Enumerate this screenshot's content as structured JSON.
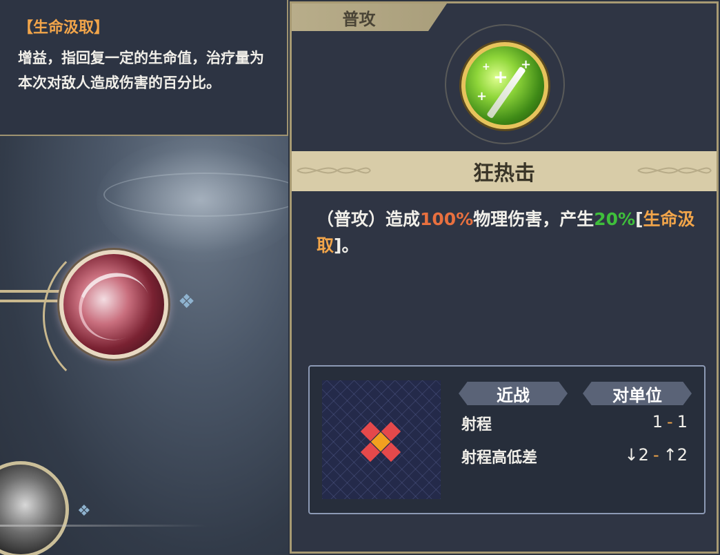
{
  "tooltip": {
    "title": "【生命汲取】",
    "body": "增益，指回复一定的生命值，治疗量为本次对敌人造成伤害的百分比。"
  },
  "panel": {
    "tab_label": "普攻",
    "skill_icon": "green-blade-icon",
    "skill_name": "狂热击",
    "description": {
      "prefix": "（普攻）造成",
      "damage_pct": "100%",
      "mid": "物理伤害，产生",
      "lifesteal_pct": "20%",
      "bracket_open": "[",
      "keyword": "生命汲取",
      "suffix": "]。"
    },
    "info": {
      "attack_type": "近战",
      "target_type": "对单位",
      "range_label": "射程",
      "range_min": "1",
      "range_max": "1",
      "height_label": "射程高低差",
      "height_down": "↓2",
      "height_up": "↑2",
      "range_separator": "-"
    }
  },
  "scene": {
    "skill_icons": [
      "red-swirl-skill-icon",
      "dark-skill-icon"
    ]
  },
  "colors": {
    "damage": "#e8703f",
    "lifesteal": "#3fbf3b",
    "keyword": "#f2a54a",
    "frame_gold": "#a89a73"
  }
}
